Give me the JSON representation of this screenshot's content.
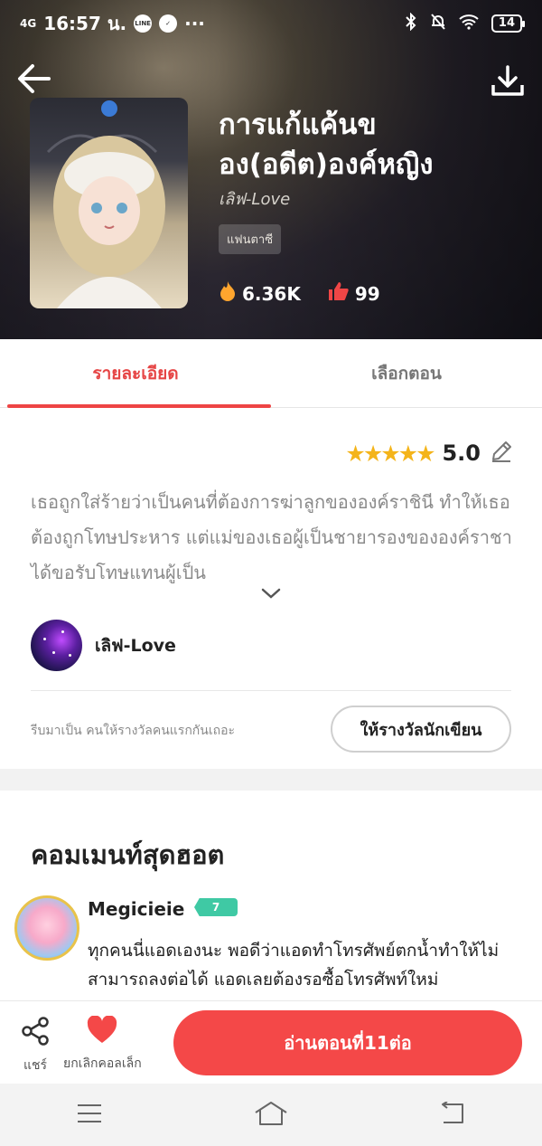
{
  "status_bar": {
    "network": "4G",
    "time": "16:57 น.",
    "line_badge": "LINE",
    "more": "···",
    "battery": "14"
  },
  "book": {
    "title_line1": "การแก้แค้นข",
    "title_line2": "อง(อดีต)องค์หญิง",
    "author": "เลิฟ-Love",
    "genre": "แฟนตาซี",
    "views": "6.36K",
    "likes": "99"
  },
  "tabs": [
    {
      "label": "รายละเอียด",
      "active": true
    },
    {
      "label": "เลือกตอน",
      "active": false
    }
  ],
  "rating": {
    "stars": "★★★★★",
    "value": "5.0"
  },
  "synopsis": "เธอถูกใส่ร้ายว่าเป็นคนที่ต้องการฆ่าลูกขององค์ราชินี ทำให้เธอต้องถูกโทษประหาร แต่แม่ของเธอผู้เป็นชายารองขององค์ราชาได้ขอรับโทษแทนผู้เป็น",
  "author_section": {
    "name": "เลิฟ-Love",
    "reward_prompt": "รีบมาเป็น คนให้รางวัลคนแรกกันเถอะ",
    "reward_button": "ให้รางวัลนักเขียน"
  },
  "hot_comments": {
    "title": "คอมเมนท์สุดฮอต",
    "comment": {
      "user": "Megicieie",
      "level": "7",
      "text": "ทุกคนนี่แอดเองนะ พอดีว่าแอดทำโทรศัพย์ตกน้ำทำให้ไม่สามารถลงต่อได้ แอดเลยต้องรอซื้อโทรศัพท์ใหม่"
    }
  },
  "bottom_bar": {
    "share_label": "แชร์",
    "fav_label": "ยกเลิกคอลเล็ก",
    "read_button": "อ่านตอนที่11ต่อ"
  },
  "colors": {
    "accent": "#f44848",
    "star": "#f4b41a",
    "badge": "#3fc9a4"
  }
}
